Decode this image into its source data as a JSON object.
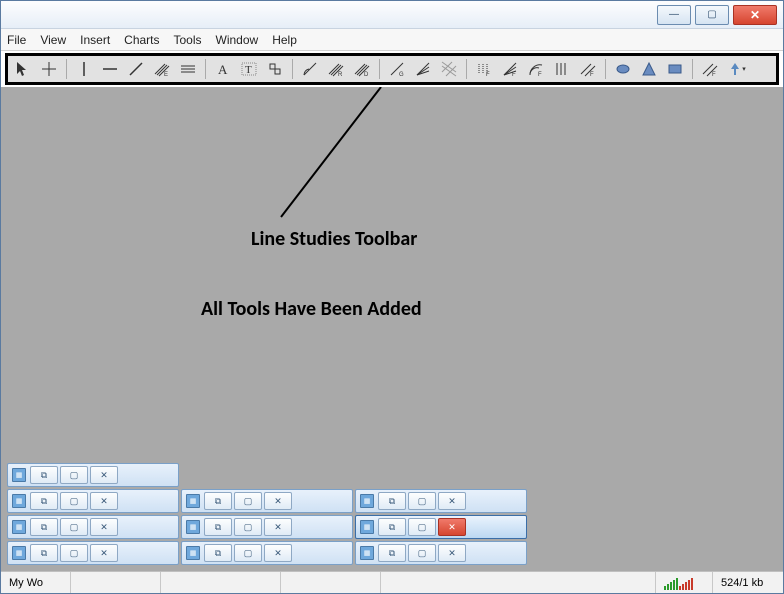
{
  "titlebar": {
    "min": "—",
    "max": "▢",
    "close": "✕"
  },
  "menu": {
    "file": "File",
    "view": "View",
    "insert": "Insert",
    "charts": "Charts",
    "tools": "Tools",
    "window": "Window",
    "help": "Help"
  },
  "toolbar_icons": [
    "cursor",
    "crosshair",
    "vertical-line",
    "horizontal-line",
    "trendline",
    "equidistant-channel",
    "channel",
    "text-label",
    "text",
    "shapes",
    "angle-trend",
    "regression",
    "stddev-channel",
    "gann-line",
    "gann-fan",
    "gann-grid",
    "fibo-retracement",
    "fibo-fan",
    "fibo-arcs",
    "fibo-channel",
    "fibo-extension",
    "fibo-timezones",
    "andrews-pitchfork",
    "cycle-lines",
    "ellipse",
    "triangle",
    "rectangle",
    "fibo-expansion",
    "arrows"
  ],
  "annotation": {
    "label1": "Line Studies Toolbar",
    "label2": "All Tools Have Been Added"
  },
  "mini_windows": {
    "row0": 1,
    "rows": 3,
    "cols": 3,
    "extra_last_row_cols": 3,
    "highlight": {
      "row": 2,
      "col": 2
    },
    "icon": "▦",
    "btns": {
      "restore": "⧉",
      "max": "▢",
      "close": "✕"
    }
  },
  "status": {
    "profile": "My Wo",
    "kb": "524/1 kb"
  }
}
